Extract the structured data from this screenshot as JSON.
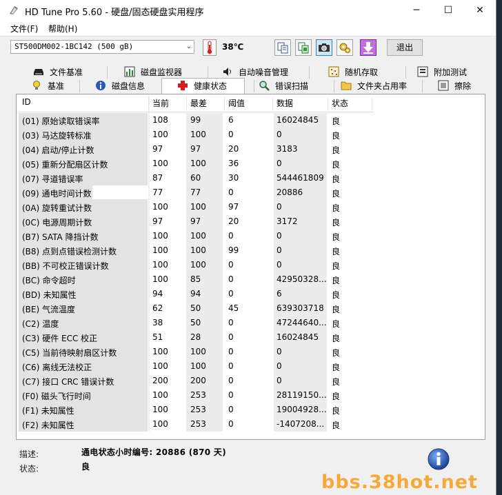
{
  "window": {
    "title": "HD Tune Pro 5.60 - 硬盘/固态硬盘实用程序",
    "minimize": "─",
    "maximize": "☐",
    "close": "✕"
  },
  "menu": {
    "file": "文件(F)",
    "help": "帮助(H)"
  },
  "toolbar": {
    "drive": "ST500DM002-1BC142 (500 gB)",
    "temperature": "38℃",
    "exit": "退出"
  },
  "tabs_top": [
    "文件基准",
    "磁盘监视器",
    "自动噪音管理",
    "随机存取",
    "附加测试"
  ],
  "tabs_bottom": [
    "基准",
    "磁盘信息",
    "健康状态",
    "错误扫描",
    "文件夹占用率",
    "擦除"
  ],
  "table": {
    "headers": [
      "ID",
      "当前",
      "最差",
      "阈值",
      "数据",
      "状态"
    ],
    "rows": [
      [
        "(01) 原始读取错误率",
        "108",
        "99",
        "6",
        "16024845",
        "良"
      ],
      [
        "(03) 马达旋转标准",
        "100",
        "100",
        "0",
        "0",
        "良"
      ],
      [
        "(04) 启动/停止计数",
        "97",
        "97",
        "20",
        "3183",
        "良"
      ],
      [
        "(05) 重新分配扇区计数",
        "100",
        "100",
        "36",
        "0",
        "良"
      ],
      [
        "(07) 寻道错误率",
        "87",
        "60",
        "30",
        "544461809",
        "良"
      ],
      [
        "(09) 通电时间计数",
        "77",
        "77",
        "0",
        "20886",
        "良"
      ],
      [
        "(0A) 旋转重试计数",
        "100",
        "100",
        "97",
        "0",
        "良"
      ],
      [
        "(0C) 电源周期计数",
        "97",
        "97",
        "20",
        "3172",
        "良"
      ],
      [
        "(B7) SATA 降挡计数",
        "100",
        "100",
        "0",
        "0",
        "良"
      ],
      [
        "(B8) 点到点错误检测计数",
        "100",
        "100",
        "99",
        "0",
        "良"
      ],
      [
        "(BB) 不可校正错误计数",
        "100",
        "100",
        "0",
        "0",
        "良"
      ],
      [
        "(BC) 命令超时",
        "100",
        "85",
        "0",
        "42950328...",
        "良"
      ],
      [
        "(BD) 未知属性",
        "94",
        "94",
        "0",
        "6",
        "良"
      ],
      [
        "(BE) 气流温度",
        "62",
        "50",
        "45",
        "639303718",
        "良"
      ],
      [
        "(C2) 温度",
        "38",
        "50",
        "0",
        "47244640...",
        "良"
      ],
      [
        "(C3) 硬件 ECC 校正",
        "51",
        "28",
        "0",
        "16024845",
        "良"
      ],
      [
        "(C5) 当前待映射扇区计数",
        "100",
        "100",
        "0",
        "0",
        "良"
      ],
      [
        "(C6) 离线无法校正",
        "100",
        "100",
        "0",
        "0",
        "良"
      ],
      [
        "(C7) 接口 CRC 错误计数",
        "200",
        "200",
        "0",
        "0",
        "良"
      ],
      [
        "(F0) 磁头飞行时间",
        "100",
        "253",
        "0",
        "28119150...",
        "良"
      ],
      [
        "(F1) 未知属性",
        "100",
        "253",
        "0",
        "19004928...",
        "良"
      ],
      [
        "(F2) 未知属性",
        "100",
        "253",
        "0",
        "-1407208...",
        "良"
      ]
    ]
  },
  "status": {
    "desc_label": "描述:",
    "desc_value": "通电状态小时编号: 20886 (870 天)",
    "state_label": "状态:",
    "state_value": "良"
  },
  "watermark": "bbs.38hot.net"
}
